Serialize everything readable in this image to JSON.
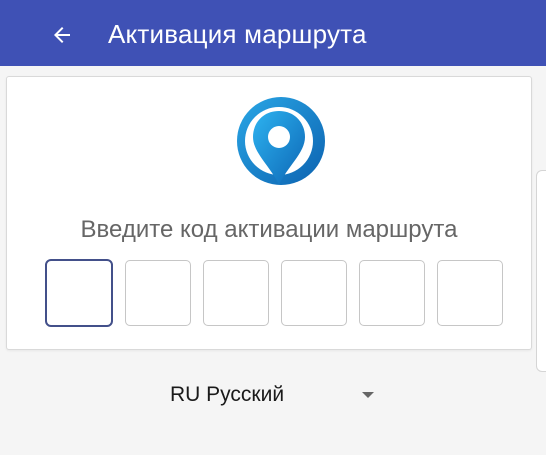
{
  "app_bar": {
    "back_icon": "arrow-left-icon",
    "title": "Активация маршрута",
    "background_color": "#3f51b5"
  },
  "activation_card": {
    "logo_icon": "location-pin-logo",
    "prompt": "Введите код активации маршрута",
    "code_boxes": [
      {
        "value": "",
        "focused": true
      },
      {
        "value": "",
        "focused": false
      },
      {
        "value": "",
        "focused": false
      },
      {
        "value": "",
        "focused": false
      },
      {
        "value": "",
        "focused": false
      },
      {
        "value": "",
        "focused": false
      }
    ],
    "focus_color": "#43508a"
  },
  "language_selector": {
    "selected": "RU Русский",
    "arrow_icon": "dropdown-arrow-icon"
  }
}
